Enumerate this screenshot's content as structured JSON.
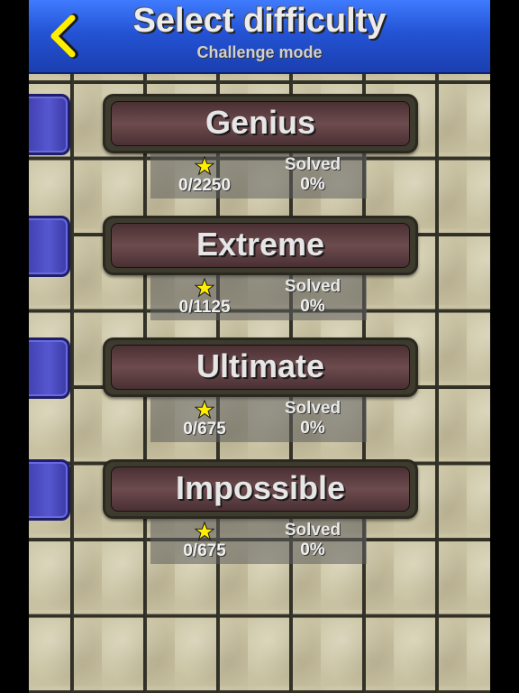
{
  "header": {
    "title": "Select difficulty",
    "subtitle": "Challenge mode",
    "back_icon": "chevron-left-icon",
    "accent_color": "#ffee00"
  },
  "levels": [
    {
      "name": "Genius",
      "stars": "0/2250",
      "solved_label": "Solved",
      "solved": "0%"
    },
    {
      "name": "Extreme",
      "stars": "0/1125",
      "solved_label": "Solved",
      "solved": "0%"
    },
    {
      "name": "Ultimate",
      "stars": "0/675",
      "solved_label": "Solved",
      "solved": "0%"
    },
    {
      "name": "Impossible",
      "stars": "0/675",
      "solved_label": "Solved",
      "solved": "0%"
    }
  ],
  "colors": {
    "header_blue": "#2453d4",
    "button_maroon": "#5a3a3d",
    "side_tab_blue": "#4a4ac0",
    "star_yellow": "#ffee00"
  }
}
